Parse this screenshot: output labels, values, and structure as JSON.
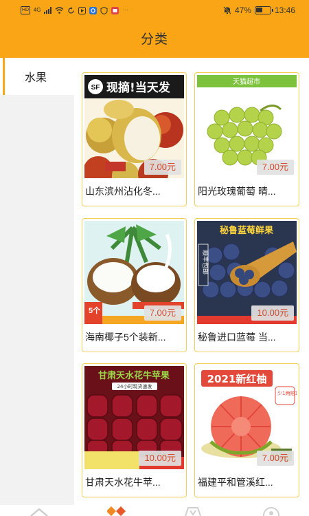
{
  "status_bar": {
    "left_badges": [
      "HD",
      "4G"
    ],
    "more": "···",
    "battery_percent": "47%",
    "time": "13:46"
  },
  "header": {
    "title": "分类"
  },
  "sidebar": {
    "items": [
      {
        "label": "水果",
        "active": true
      }
    ]
  },
  "products": [
    {
      "name": "山东滨州沾化冬...",
      "price": "7.00元",
      "banner": "现摘!当天发",
      "badge": "SF",
      "image": "winter-jujube"
    },
    {
      "name": "阳光玫瑰葡萄 晴...",
      "price": "7.00元",
      "banner": "天猫超市",
      "image": "shine-muscat-grape"
    },
    {
      "name": "海南椰子5个装新...",
      "price": "7.00元",
      "banner": "5个",
      "image": "coconut"
    },
    {
      "name": "秘鲁进口蓝莓 当...",
      "price": "10.00元",
      "banner": "秘鲁蓝莓鲜果",
      "badge": "顺丰包邮",
      "image": "blueberry"
    },
    {
      "name": "甘肃天水花牛苹...",
      "price": "10.00元",
      "banner": "甘肃天水花牛苹果",
      "sub_banner": "24小时现货速发",
      "image": "red-apple"
    },
    {
      "name": "福建平和管溪红...",
      "price": "7.00元",
      "banner": "2021新红柚",
      "sub_banner": "少1两赔1斤",
      "image": "red-pomelo"
    }
  ],
  "colors": {
    "accent": "#f9a515",
    "card_border": "#f5cf55",
    "price": "#d44a2a"
  }
}
